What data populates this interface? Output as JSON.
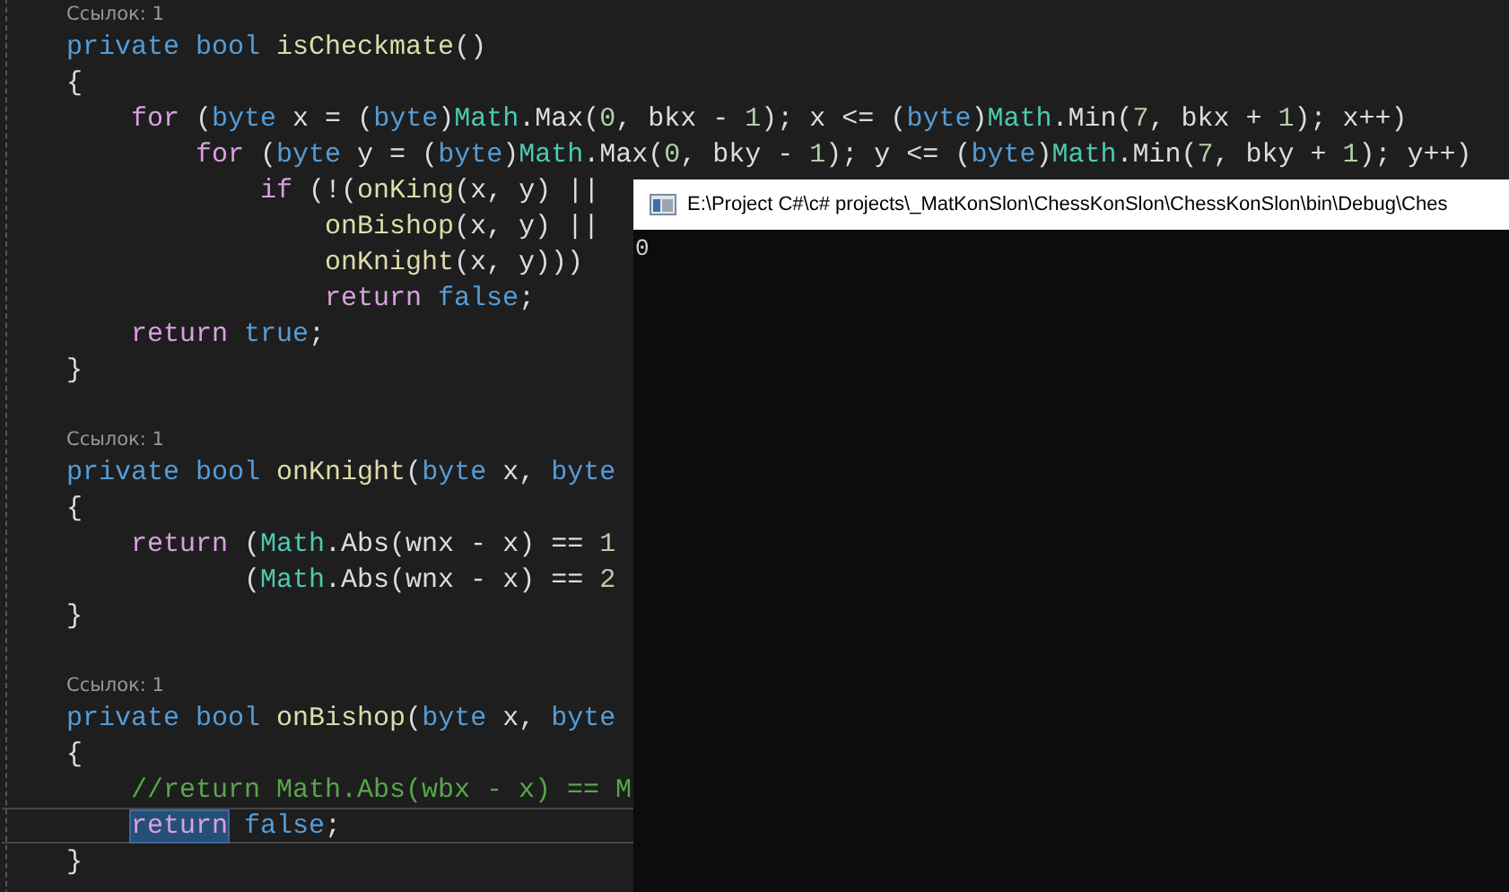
{
  "editor": {
    "lines": [
      {
        "kind": "lens",
        "text": "Ссылок: 1"
      },
      {
        "kind": "code",
        "tokens": [
          {
            "text": "private bool",
            "kind": "keyword"
          },
          {
            "text": " isCheckmate",
            "kind": "method"
          },
          {
            "text": "()",
            "kind": "plain"
          }
        ]
      },
      {
        "kind": "code",
        "tokens": [
          {
            "text": "{",
            "kind": "plain"
          }
        ],
        "children": [
          {
            "kind": "code",
            "tokens": [
              {
                "text": "for",
                "kind": "control"
              },
              {
                "text": " (",
                "kind": "plain"
              },
              {
                "text": "byte",
                "kind": "keyword"
              },
              {
                "text": " x = (",
                "kind": "plain"
              },
              {
                "text": "byte",
                "kind": "keyword"
              },
              {
                "text": ")",
                "kind": "plain"
              },
              {
                "text": "Math",
                "kind": "type"
              },
              {
                "text": ".Max(",
                "kind": "plain"
              },
              {
                "text": "0",
                "kind": "number"
              },
              {
                "text": ", bkx - ",
                "kind": "plain"
              },
              {
                "text": "1",
                "kind": "number"
              },
              {
                "text": "); x <= (",
                "kind": "plain"
              },
              {
                "text": "byte",
                "kind": "keyword"
              },
              {
                "text": ")",
                "kind": "plain"
              },
              {
                "text": "Math",
                "kind": "type"
              },
              {
                "text": ".Min(",
                "kind": "plain"
              },
              {
                "text": "7",
                "kind": "number"
              },
              {
                "text": ", bkx + ",
                "kind": "plain"
              },
              {
                "text": "1",
                "kind": "number"
              },
              {
                "text": "); x++)",
                "kind": "plain"
              }
            ],
            "children": [
              {
                "kind": "code",
                "tokens": [
                  {
                    "text": "for",
                    "kind": "control"
                  },
                  {
                    "text": " (",
                    "kind": "plain"
                  },
                  {
                    "text": "byte",
                    "kind": "keyword"
                  },
                  {
                    "text": " y = (",
                    "kind": "plain"
                  },
                  {
                    "text": "byte",
                    "kind": "keyword"
                  },
                  {
                    "text": ")",
                    "kind": "plain"
                  },
                  {
                    "text": "Math",
                    "kind": "type"
                  },
                  {
                    "text": ".Max(",
                    "kind": "plain"
                  },
                  {
                    "text": "0",
                    "kind": "number"
                  },
                  {
                    "text": ", bky - ",
                    "kind": "plain"
                  },
                  {
                    "text": "1",
                    "kind": "number"
                  },
                  {
                    "text": "); y <= (",
                    "kind": "plain"
                  },
                  {
                    "text": "byte",
                    "kind": "keyword"
                  },
                  {
                    "text": ")",
                    "kind": "plain"
                  },
                  {
                    "text": "Math",
                    "kind": "type"
                  },
                  {
                    "text": ".Min(",
                    "kind": "plain"
                  },
                  {
                    "text": "7",
                    "kind": "number"
                  },
                  {
                    "text": ", bky + ",
                    "kind": "plain"
                  },
                  {
                    "text": "1",
                    "kind": "number"
                  },
                  {
                    "text": "); y++)",
                    "kind": "plain"
                  }
                ],
                "children": [
                  {
                    "kind": "code",
                    "tokens": [
                      {
                        "text": "if",
                        "kind": "control"
                      },
                      {
                        "text": " (!(",
                        "kind": "plain"
                      },
                      {
                        "text": "onKing",
                        "kind": "method"
                      },
                      {
                        "text": "(x, y) ||",
                        "kind": "plain"
                      }
                    ],
                    "children": [
                      {
                        "kind": "code",
                        "tokens": [
                          {
                            "text": "onBishop",
                            "kind": "method"
                          },
                          {
                            "text": "(x, y) ||",
                            "kind": "plain"
                          }
                        ]
                      },
                      {
                        "kind": "code",
                        "tokens": [
                          {
                            "text": "onKnight",
                            "kind": "method"
                          },
                          {
                            "text": "(x, y)))",
                            "kind": "plain"
                          }
                        ]
                      },
                      {
                        "kind": "code",
                        "tokens": [
                          {
                            "text": "return",
                            "kind": "control"
                          },
                          {
                            "text": " false",
                            "kind": "keyword"
                          },
                          {
                            "text": ";",
                            "kind": "plain"
                          }
                        ]
                      }
                    ]
                  }
                ]
              }
            ]
          },
          {
            "kind": "code",
            "tokens": [
              {
                "text": "return",
                "kind": "control"
              },
              {
                "text": " true",
                "kind": "keyword"
              },
              {
                "text": ";",
                "kind": "plain"
              }
            ]
          }
        ]
      },
      {
        "kind": "code",
        "tokens": [
          {
            "text": "}",
            "kind": "plain"
          }
        ]
      },
      {
        "kind": "blank"
      },
      {
        "kind": "lens",
        "text": "Ссылок: 1"
      },
      {
        "kind": "code",
        "tokens": [
          {
            "text": "private bool",
            "kind": "keyword"
          },
          {
            "text": " onKnight",
            "kind": "method"
          },
          {
            "text": "(",
            "kind": "plain"
          },
          {
            "text": "byte",
            "kind": "keyword"
          },
          {
            "text": " x, ",
            "kind": "plain"
          },
          {
            "text": "byte",
            "kind": "keyword"
          }
        ]
      },
      {
        "kind": "code",
        "tokens": [
          {
            "text": "{",
            "kind": "plain"
          }
        ],
        "children": [
          {
            "kind": "code",
            "tokens": [
              {
                "text": "return",
                "kind": "control"
              },
              {
                "text": " (",
                "kind": "plain"
              },
              {
                "text": "Math",
                "kind": "type"
              },
              {
                "text": ".Abs(wnx - x) == ",
                "kind": "plain"
              },
              {
                "text": "1",
                "kind": "number"
              }
            ],
            "children": [
              {
                "kind": "continuation",
                "tokens": [
                  {
                    "text": "(",
                    "kind": "plain"
                  },
                  {
                    "text": "Math",
                    "kind": "type"
                  },
                  {
                    "text": ".Abs(wnx - x) == ",
                    "kind": "plain"
                  },
                  {
                    "text": "2",
                    "kind": "number"
                  }
                ]
              }
            ]
          }
        ]
      },
      {
        "kind": "code",
        "tokens": [
          {
            "text": "}",
            "kind": "plain"
          }
        ]
      },
      {
        "kind": "blank"
      },
      {
        "kind": "lens",
        "text": "Ссылок: 1"
      },
      {
        "kind": "code",
        "tokens": [
          {
            "text": "private bool",
            "kind": "keyword"
          },
          {
            "text": " onBishop",
            "kind": "method"
          },
          {
            "text": "(",
            "kind": "plain"
          },
          {
            "text": "byte",
            "kind": "keyword"
          },
          {
            "text": " x, ",
            "kind": "plain"
          },
          {
            "text": "byte",
            "kind": "keyword"
          }
        ]
      },
      {
        "kind": "code",
        "tokens": [
          {
            "text": "{",
            "kind": "plain"
          }
        ],
        "children": [
          {
            "kind": "code",
            "tokens": [
              {
                "text": "//return Math.Abs(wbx - x) == M",
                "kind": "comment"
              }
            ]
          },
          {
            "kind": "code",
            "current": true,
            "tokens": [
              {
                "text": "return",
                "kind": "control",
                "highlighted": true
              },
              {
                "text": " false",
                "kind": "keyword"
              },
              {
                "text": ";",
                "kind": "plain"
              }
            ]
          }
        ]
      },
      {
        "kind": "code",
        "tokens": [
          {
            "text": "}",
            "kind": "plain"
          }
        ]
      }
    ]
  },
  "console": {
    "title": "E:\\Project C#\\c# projects\\_MatKonSlon\\ChessKonSlon\\ChessKonSlon\\bin\\Debug\\Ches",
    "output": "0"
  }
}
